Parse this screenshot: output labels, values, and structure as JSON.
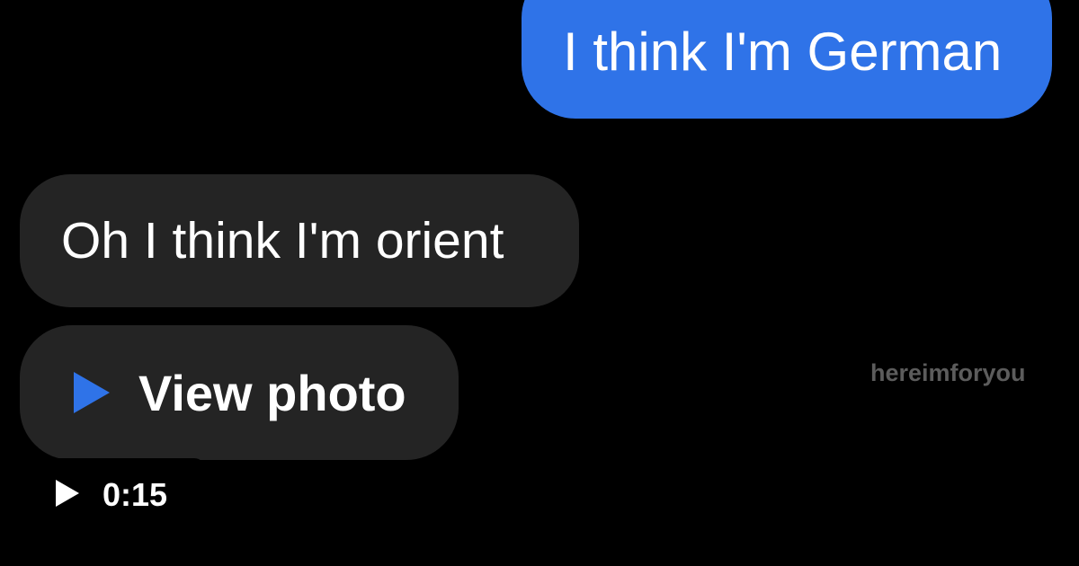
{
  "messages": [
    {
      "direction": "outgoing",
      "text": "I think I'm German"
    },
    {
      "direction": "incoming",
      "text": "Oh I think I'm orient"
    },
    {
      "direction": "incoming",
      "text": "View photo",
      "icon": "play-triangle-icon"
    }
  ],
  "watermark": "hereimforyou",
  "player": {
    "icon": "play-icon",
    "duration": "0:15"
  },
  "colors": {
    "background": "#000000",
    "outgoing_bubble": "#2f73e8",
    "incoming_bubble": "#242424",
    "accent": "#2f73e8",
    "watermark": "#5c5c5c"
  }
}
